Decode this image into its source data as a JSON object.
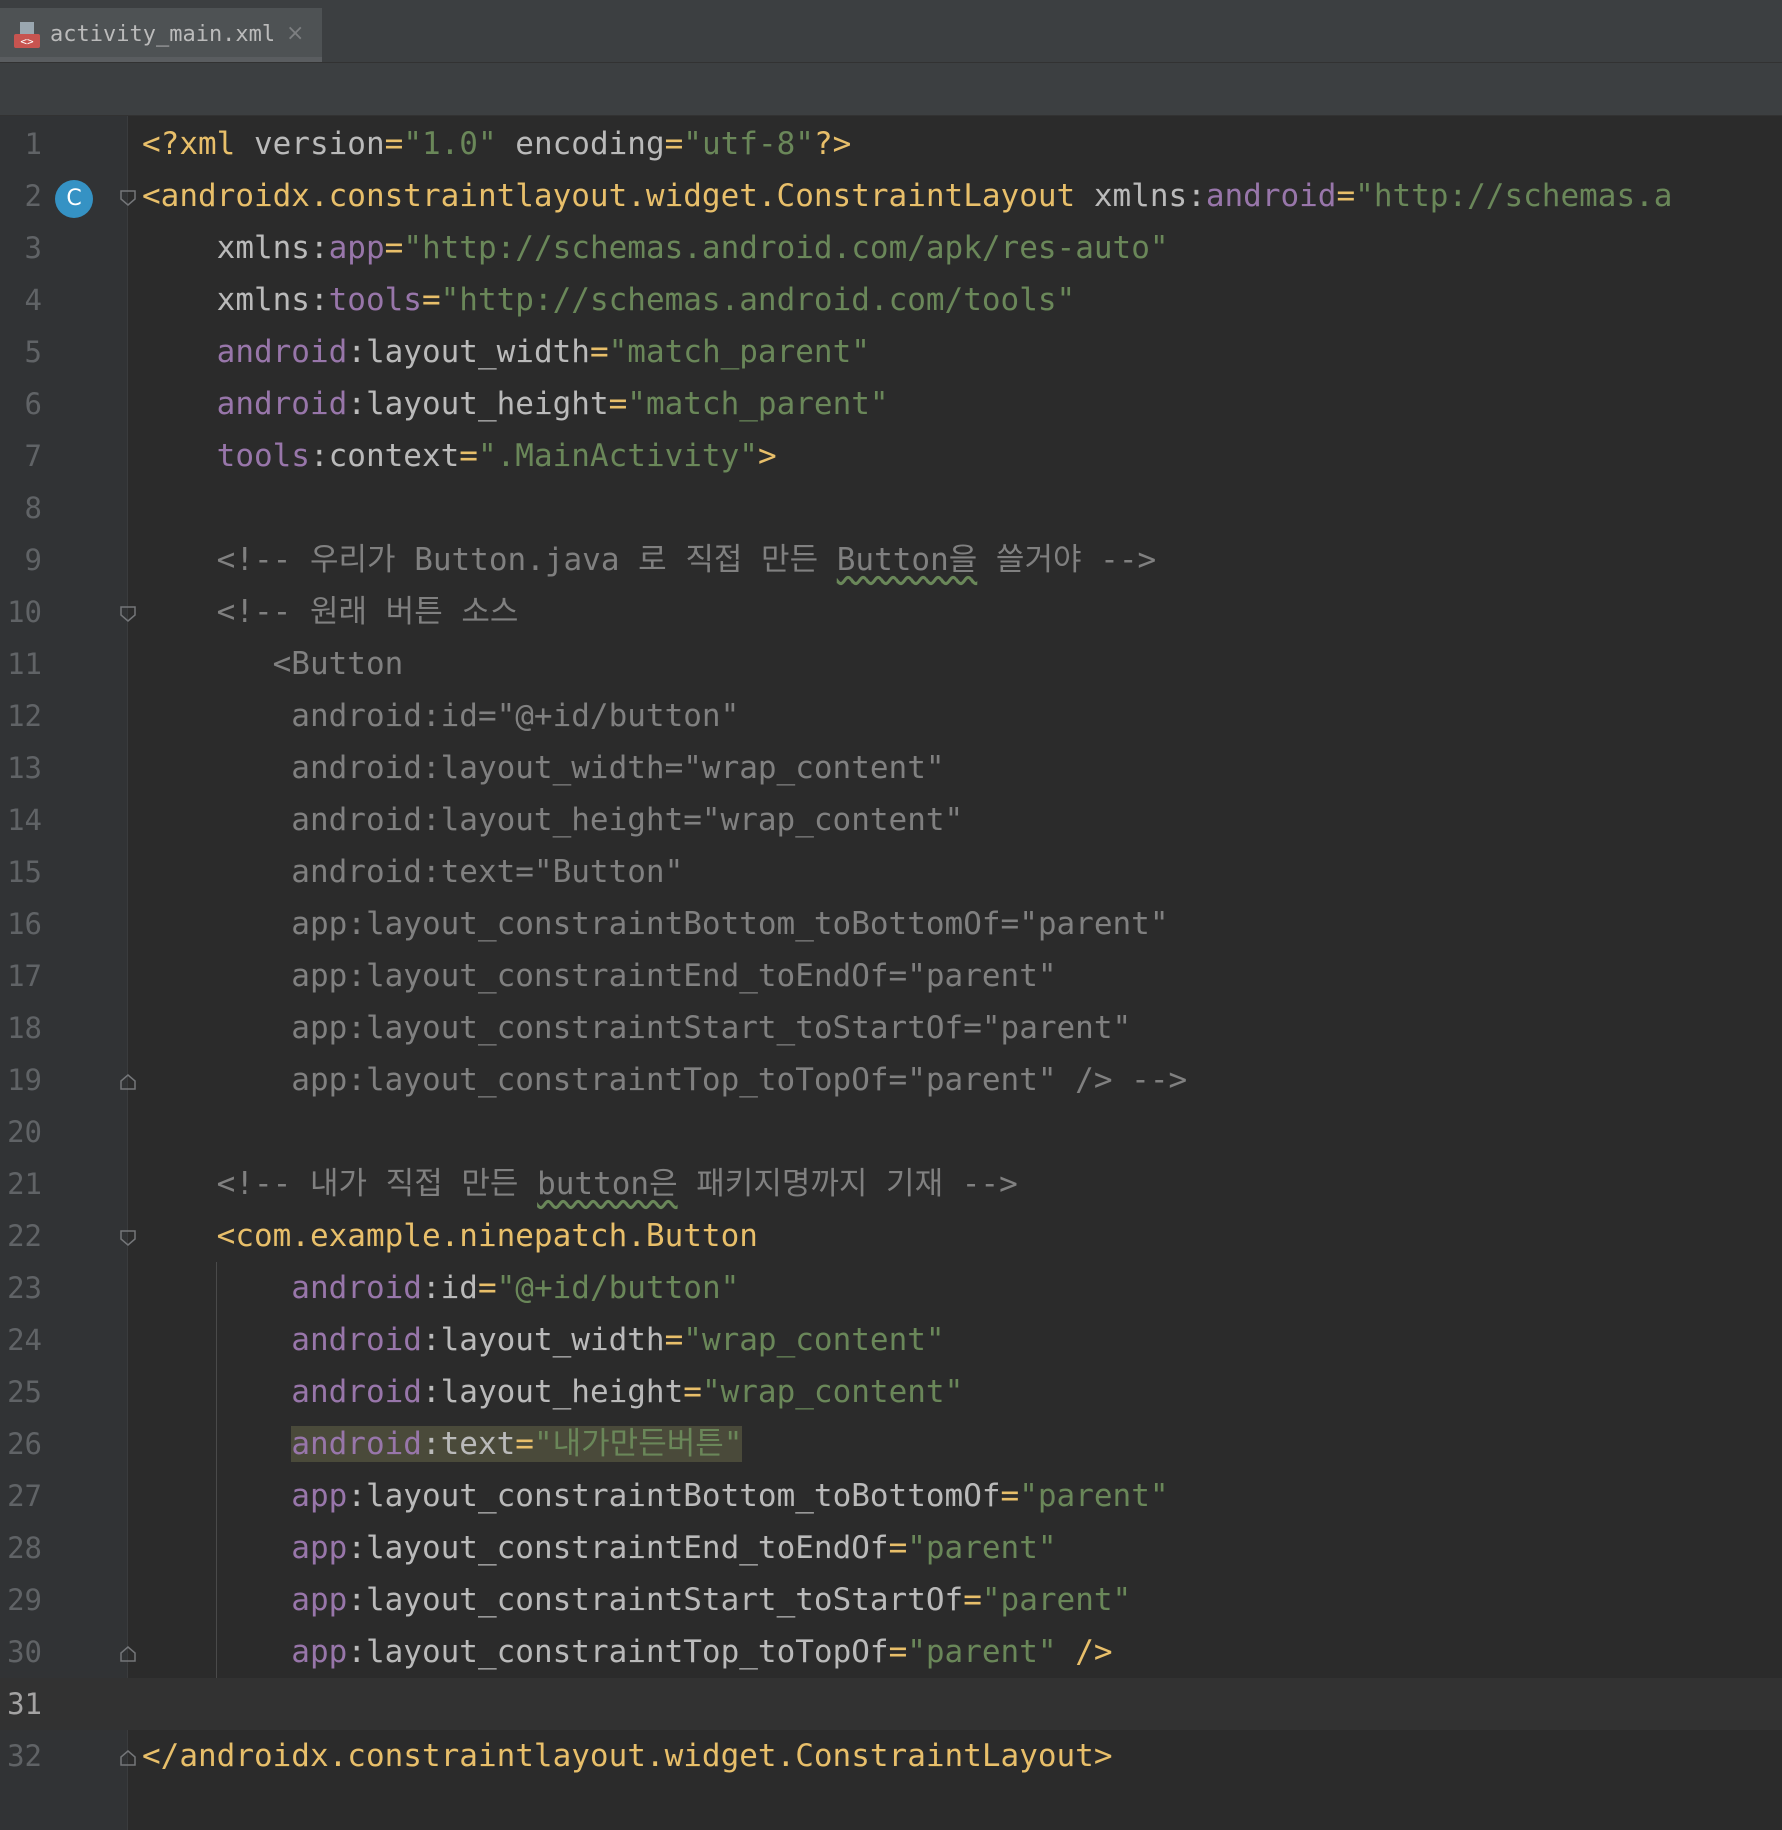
{
  "tab": {
    "file_name": "activity_main.xml",
    "close_symbol": "×",
    "icon": "xml-file-icon"
  },
  "colors": {
    "tag": "#e8bf6a",
    "attr": "#bababa",
    "namespace": "#9876aa",
    "value": "#6a8759",
    "comment": "#808080",
    "background": "#2b2b2b",
    "gutter": "#313335"
  },
  "gutter": {
    "badge_letter": "C"
  },
  "lines": [
    {
      "n": "1",
      "parts": [
        [
          "t",
          "<?xml "
        ],
        [
          "a",
          "version"
        ],
        [
          "t",
          "="
        ],
        [
          "s",
          "\"1.0\""
        ],
        [
          "a",
          " encoding"
        ],
        [
          "t",
          "="
        ],
        [
          "s",
          "\"utf-8\""
        ],
        [
          "t",
          "?>"
        ]
      ]
    },
    {
      "n": "2",
      "parts": [
        [
          "t",
          "<androidx.constraintlayout.widget.ConstraintLayout "
        ],
        [
          "a",
          "xmlns:"
        ],
        [
          "ns",
          "android"
        ],
        [
          "t",
          "="
        ],
        [
          "s",
          "\"http://schemas.a"
        ]
      ]
    },
    {
      "n": "3",
      "parts": [
        [
          "a",
          "    xmlns:"
        ],
        [
          "ns",
          "app"
        ],
        [
          "t",
          "="
        ],
        [
          "s",
          "\"http://schemas.android.com/apk/res-auto\""
        ]
      ]
    },
    {
      "n": "4",
      "parts": [
        [
          "a",
          "    xmlns:"
        ],
        [
          "ns",
          "tools"
        ],
        [
          "t",
          "="
        ],
        [
          "s",
          "\"http://schemas.android.com/tools\""
        ]
      ]
    },
    {
      "n": "5",
      "parts": [
        [
          "ns",
          "    android"
        ],
        [
          "a",
          ":layout_width"
        ],
        [
          "t",
          "="
        ],
        [
          "s",
          "\"match_parent\""
        ]
      ]
    },
    {
      "n": "6",
      "parts": [
        [
          "ns",
          "    android"
        ],
        [
          "a",
          ":layout_height"
        ],
        [
          "t",
          "="
        ],
        [
          "s",
          "\"match_parent\""
        ]
      ]
    },
    {
      "n": "7",
      "parts": [
        [
          "ns",
          "    tools"
        ],
        [
          "a",
          ":context"
        ],
        [
          "t",
          "="
        ],
        [
          "s",
          "\".MainActivity\""
        ],
        [
          "t",
          ">"
        ]
      ]
    },
    {
      "n": "8",
      "parts": []
    },
    {
      "n": "9",
      "parts": [
        [
          "c",
          "    <!-- 우리가 Button.java 로 직접 만든 "
        ],
        [
          "cw",
          "Button을"
        ],
        [
          "c",
          " 쓸거야 -->"
        ]
      ]
    },
    {
      "n": "10",
      "parts": [
        [
          "c",
          "    <!-- 원래 버튼 소스"
        ]
      ]
    },
    {
      "n": "11",
      "parts": [
        [
          "c",
          "       <Button"
        ]
      ]
    },
    {
      "n": "12",
      "parts": [
        [
          "c",
          "        android:id=\"@+id/button\""
        ]
      ]
    },
    {
      "n": "13",
      "parts": [
        [
          "c",
          "        android:layout_width=\"wrap_content\""
        ]
      ]
    },
    {
      "n": "14",
      "parts": [
        [
          "c",
          "        android:layout_height=\"wrap_content\""
        ]
      ]
    },
    {
      "n": "15",
      "parts": [
        [
          "c",
          "        android:text=\"Button\""
        ]
      ]
    },
    {
      "n": "16",
      "parts": [
        [
          "c",
          "        app:layout_constraintBottom_toBottomOf=\"parent\""
        ]
      ]
    },
    {
      "n": "17",
      "parts": [
        [
          "c",
          "        app:layout_constraintEnd_toEndOf=\"parent\""
        ]
      ]
    },
    {
      "n": "18",
      "parts": [
        [
          "c",
          "        app:layout_constraintStart_toStartOf=\"parent\""
        ]
      ]
    },
    {
      "n": "19",
      "parts": [
        [
          "c",
          "        app:layout_constraintTop_toTopOf=\"parent\" /> -->"
        ]
      ]
    },
    {
      "n": "20",
      "parts": []
    },
    {
      "n": "21",
      "parts": [
        [
          "c",
          "    <!-- 내가 직접 만든 "
        ],
        [
          "cw",
          "button은"
        ],
        [
          "c",
          " 패키지명까지 기재 -->"
        ]
      ]
    },
    {
      "n": "22",
      "parts": [
        [
          "t",
          "    <com.example.ninepatch.Button"
        ]
      ]
    },
    {
      "n": "23",
      "parts": [
        [
          "ns",
          "        android"
        ],
        [
          "a",
          ":id"
        ],
        [
          "t",
          "="
        ],
        [
          "s",
          "\"@+id/button\""
        ]
      ]
    },
    {
      "n": "24",
      "parts": [
        [
          "ns",
          "        android"
        ],
        [
          "a",
          ":layout_width"
        ],
        [
          "t",
          "="
        ],
        [
          "s",
          "\"wrap_content\""
        ]
      ]
    },
    {
      "n": "25",
      "parts": [
        [
          "ns",
          "        android"
        ],
        [
          "a",
          ":layout_height"
        ],
        [
          "t",
          "="
        ],
        [
          "s",
          "\"wrap_content\""
        ]
      ]
    },
    {
      "n": "26",
      "parts": [
        [
          "a",
          "        "
        ],
        [
          "hns",
          "android"
        ],
        [
          "ha",
          ":text"
        ],
        [
          "ht",
          "="
        ],
        [
          "hs",
          "\"내가만든버튼\""
        ]
      ]
    },
    {
      "n": "27",
      "parts": [
        [
          "ns",
          "        app"
        ],
        [
          "a",
          ":layout_constraintBottom_toBottomOf"
        ],
        [
          "t",
          "="
        ],
        [
          "s",
          "\"parent\""
        ]
      ]
    },
    {
      "n": "28",
      "parts": [
        [
          "ns",
          "        app"
        ],
        [
          "a",
          ":layout_constraintEnd_toEndOf"
        ],
        [
          "t",
          "="
        ],
        [
          "s",
          "\"parent\""
        ]
      ]
    },
    {
      "n": "29",
      "parts": [
        [
          "ns",
          "        app"
        ],
        [
          "a",
          ":layout_constraintStart_toStartOf"
        ],
        [
          "t",
          "="
        ],
        [
          "s",
          "\"parent\""
        ]
      ]
    },
    {
      "n": "30",
      "parts": [
        [
          "ns",
          "        app"
        ],
        [
          "a",
          ":layout_constraintTop_toTopOf"
        ],
        [
          "t",
          "="
        ],
        [
          "s",
          "\"parent\""
        ],
        [
          "t",
          " />"
        ]
      ]
    },
    {
      "n": "31",
      "parts": [],
      "current": true
    },
    {
      "n": "32",
      "parts": [
        [
          "t",
          "</androidx.constraintlayout.widget.ConstraintLayout>"
        ]
      ]
    }
  ]
}
